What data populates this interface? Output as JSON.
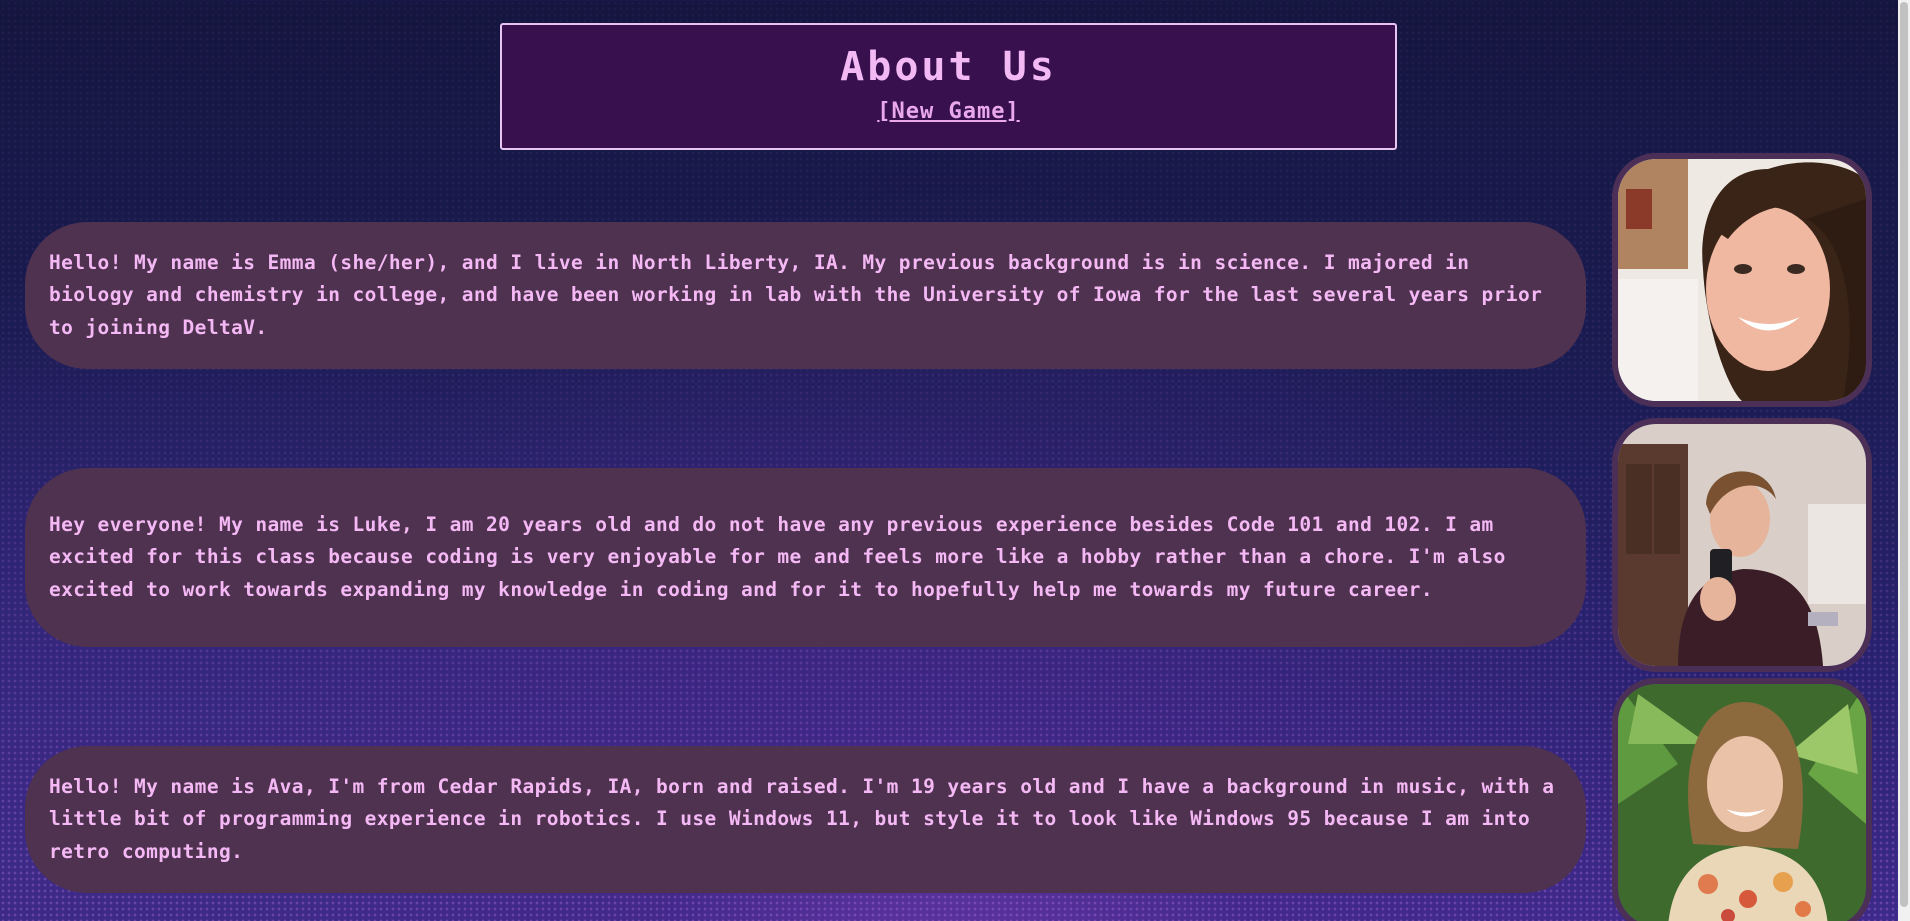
{
  "header": {
    "title": "About Us",
    "new_game_link": "[New Game]"
  },
  "members": [
    {
      "name": "Emma",
      "bio": "Hello! My name is Emma (she/her), and I live in North Liberty, IA. My previous background is in science. I majored in biology and chemistry in college, and have been working in lab with the University of Iowa for the last several years prior to joining DeltaV.",
      "photo_icon": "portrait-photo"
    },
    {
      "name": "Luke",
      "bio": "Hey everyone! My name is Luke, I am 20 years old and do not have any previous experience besides Code 101 and 102. I am excited for this class because coding is very enjoyable for me and feels more like a hobby rather than a chore. I'm also excited to work towards expanding my knowledge in coding and for it to hopefully help me towards my future career.",
      "photo_icon": "portrait-photo"
    },
    {
      "name": "Ava",
      "bio": "Hello! My name is Ava, I'm from Cedar Rapids, IA, born and raised. I'm 19 years old and I have a background in music, with a little bit of programming experience in robotics. I use Windows 11, but style it to look like Windows 95 because I am into retro computing.",
      "photo_icon": "portrait-photo"
    }
  ],
  "colors": {
    "accent_text": "#f4b9f5",
    "bubble_bg": "#4f3150",
    "header_bg": "#38104e",
    "header_border": "#e7c4f2"
  }
}
